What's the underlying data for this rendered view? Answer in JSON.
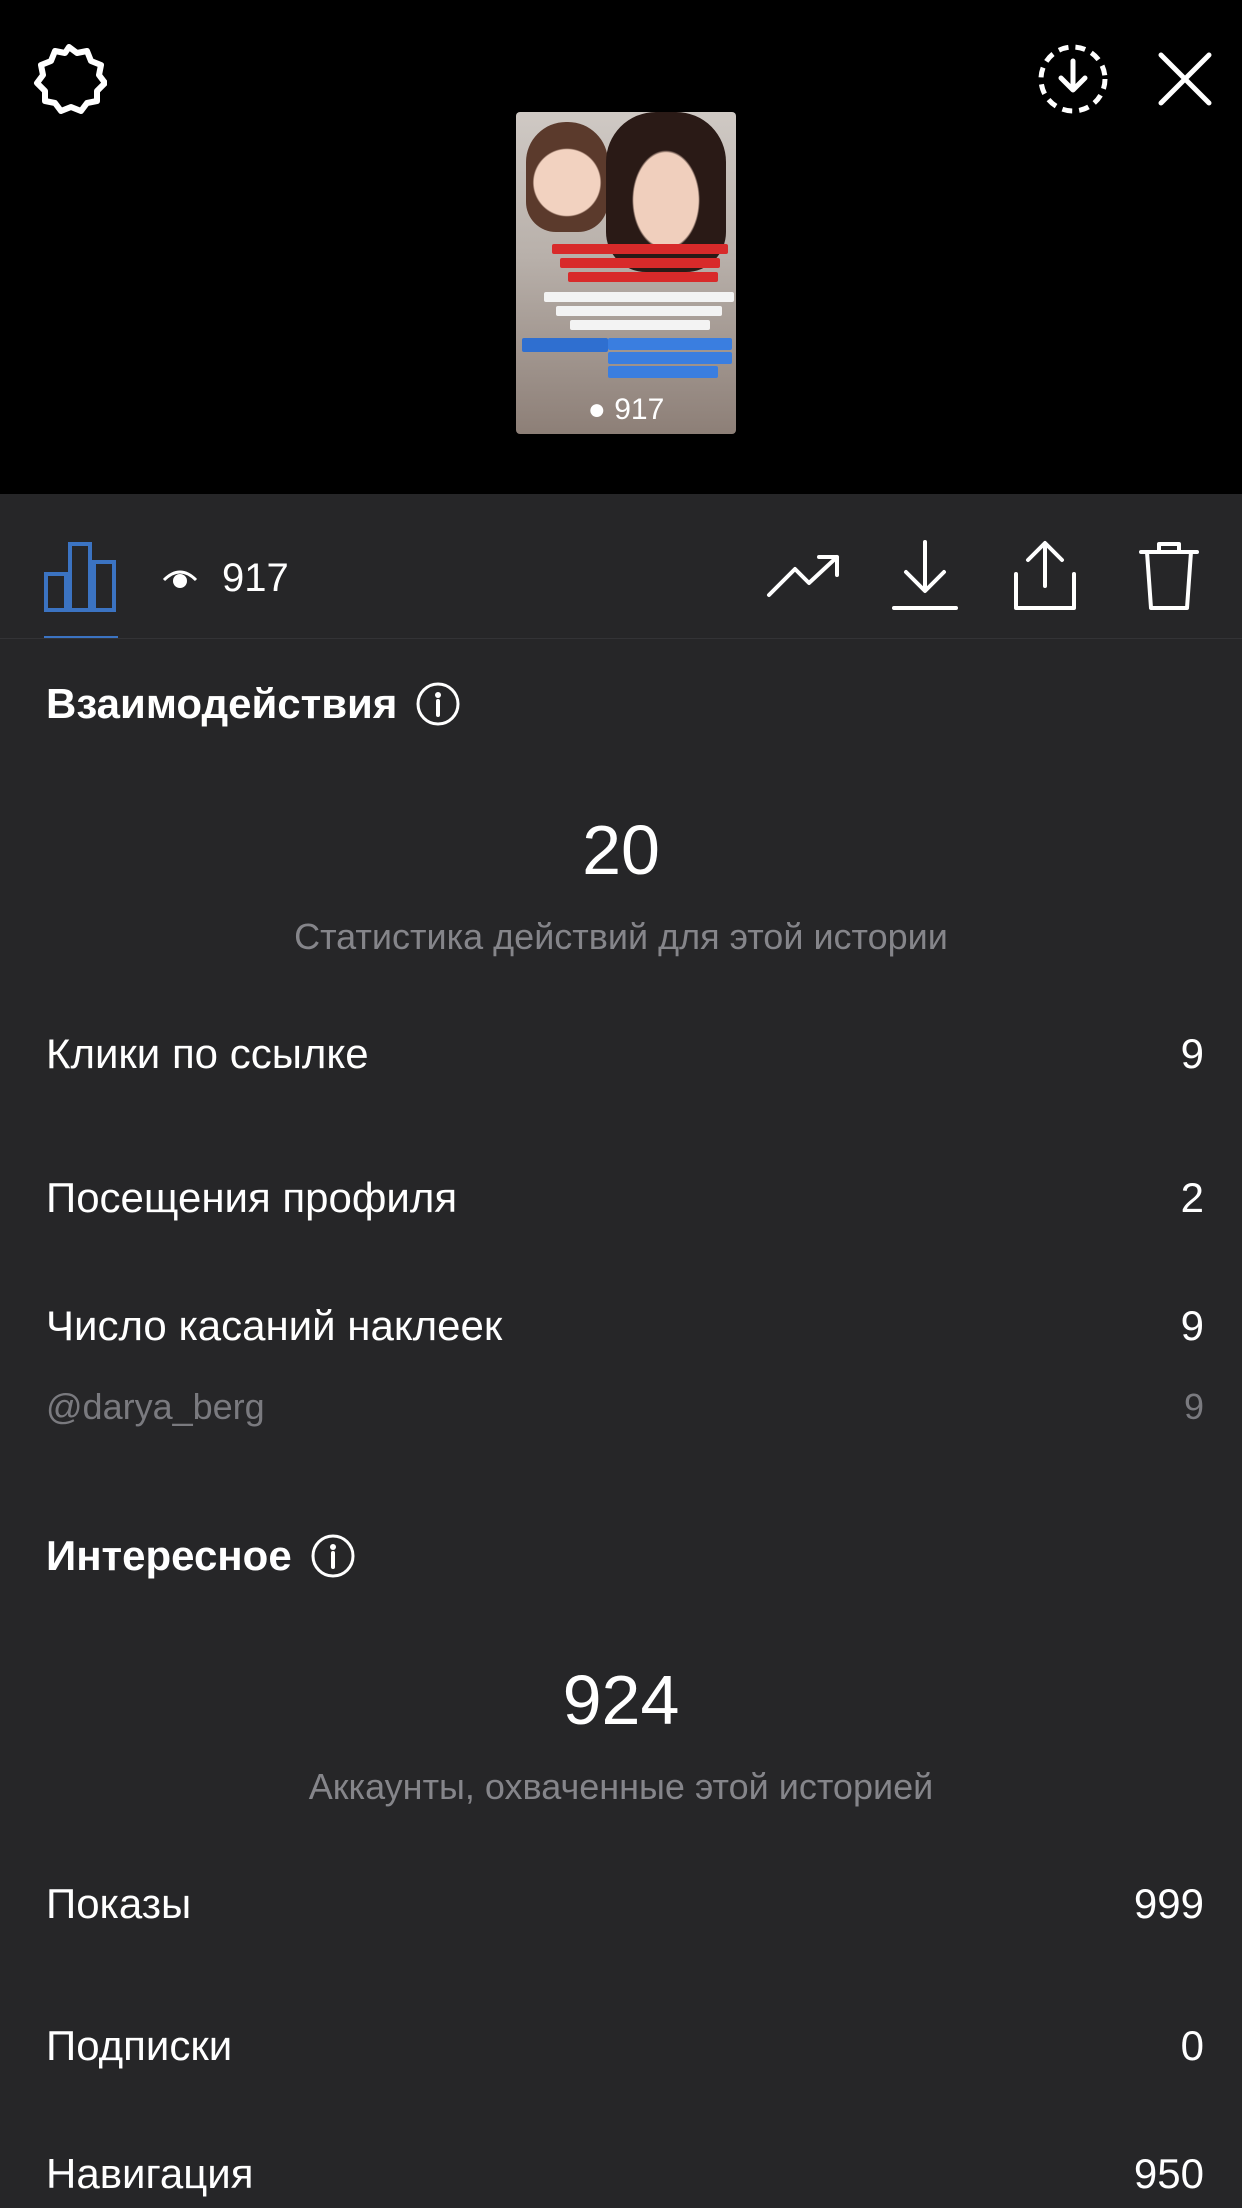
{
  "preview": {
    "views": "917"
  },
  "toolbar": {
    "views": "917"
  },
  "interactions": {
    "title": "Взаимодействия",
    "total": "20",
    "caption": "Статистика действий для этой истории",
    "rows": [
      {
        "label": "Клики по ссылке",
        "value": "9"
      },
      {
        "label": "Посещения профиля",
        "value": "2"
      },
      {
        "label": "Число касаний наклеек",
        "value": "9"
      }
    ],
    "sticker_sub": {
      "label": "@darya_berg",
      "value": "9"
    }
  },
  "discovery": {
    "title": "Интересное",
    "total": "924",
    "caption": "Аккаунты, охваченные этой историей",
    "rows": [
      {
        "label": "Показы",
        "value": "999"
      },
      {
        "label": "Подписки",
        "value": "0"
      },
      {
        "label": "Навигация",
        "value": "950"
      }
    ]
  },
  "colors": {
    "accent": "#3b73c2",
    "panel": "#262628",
    "top": "#000000",
    "muted": "#85858a"
  }
}
